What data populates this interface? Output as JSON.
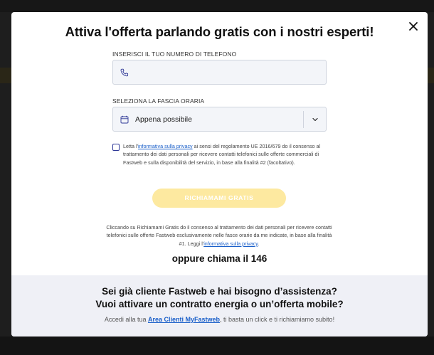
{
  "colors": {
    "backdrop": "#1e1e1e",
    "modal_bg": "#ffffff",
    "input_bg": "#f3f5f9",
    "link": "#1a5fc9",
    "cta_disabled_bg": "#fde9a0",
    "footer_bg": "#eff0f6",
    "checkbox_border": "#2d3796"
  },
  "modal": {
    "title": "Attiva l'offerta parlando gratis con i nostri esperti!",
    "close_icon": "close-icon"
  },
  "phone_field": {
    "label": "INSERISCI IL TUO NUMERO DI TELEFONO",
    "value": "",
    "icon": "phone-icon"
  },
  "time_slot": {
    "label": "SELEZIONA LA FASCIA ORARIA",
    "selected": "Appena possibile",
    "icon": "calendar-icon",
    "chevron": "chevron-down-icon"
  },
  "consent": {
    "checked": false,
    "text_before": "Letta l'",
    "link": "informativa sulla privacy",
    "text_after": " ai sensi del regolamento UE 2016/679 do il consenso al trattamento dei dati personali per ricevere contatti telefonici sulle offerte commerciali di Fastweb e sulla disponibilità del servizio, in base alla finalità #2 (facoltativo)."
  },
  "cta": {
    "label": "RICHIAMAMI GRATIS",
    "enabled": false
  },
  "notice": {
    "text": "Cliccando su Richiamami Gratis do il consenso al trattamento dei dati personali per ricevere contatti telefonici sulle offerte Fastweb esclusivamente nelle fasce orarie da me indicate, in base alla finalità #1. Leggi l'",
    "link": "informativa sulla privacy",
    "end": "."
  },
  "call_line": "oppure chiama il 146",
  "footer": {
    "line1": "Sei già cliente Fastweb e hai bisogno d’assistenza?",
    "line2": "Vuoi attivare un contratto energia o un’offerta mobile?",
    "sub_before": "Accedi alla tua ",
    "sub_link": "Area Clienti MyFastweb",
    "sub_after": ", ti basta un click e ti richiamiamo subito!"
  }
}
